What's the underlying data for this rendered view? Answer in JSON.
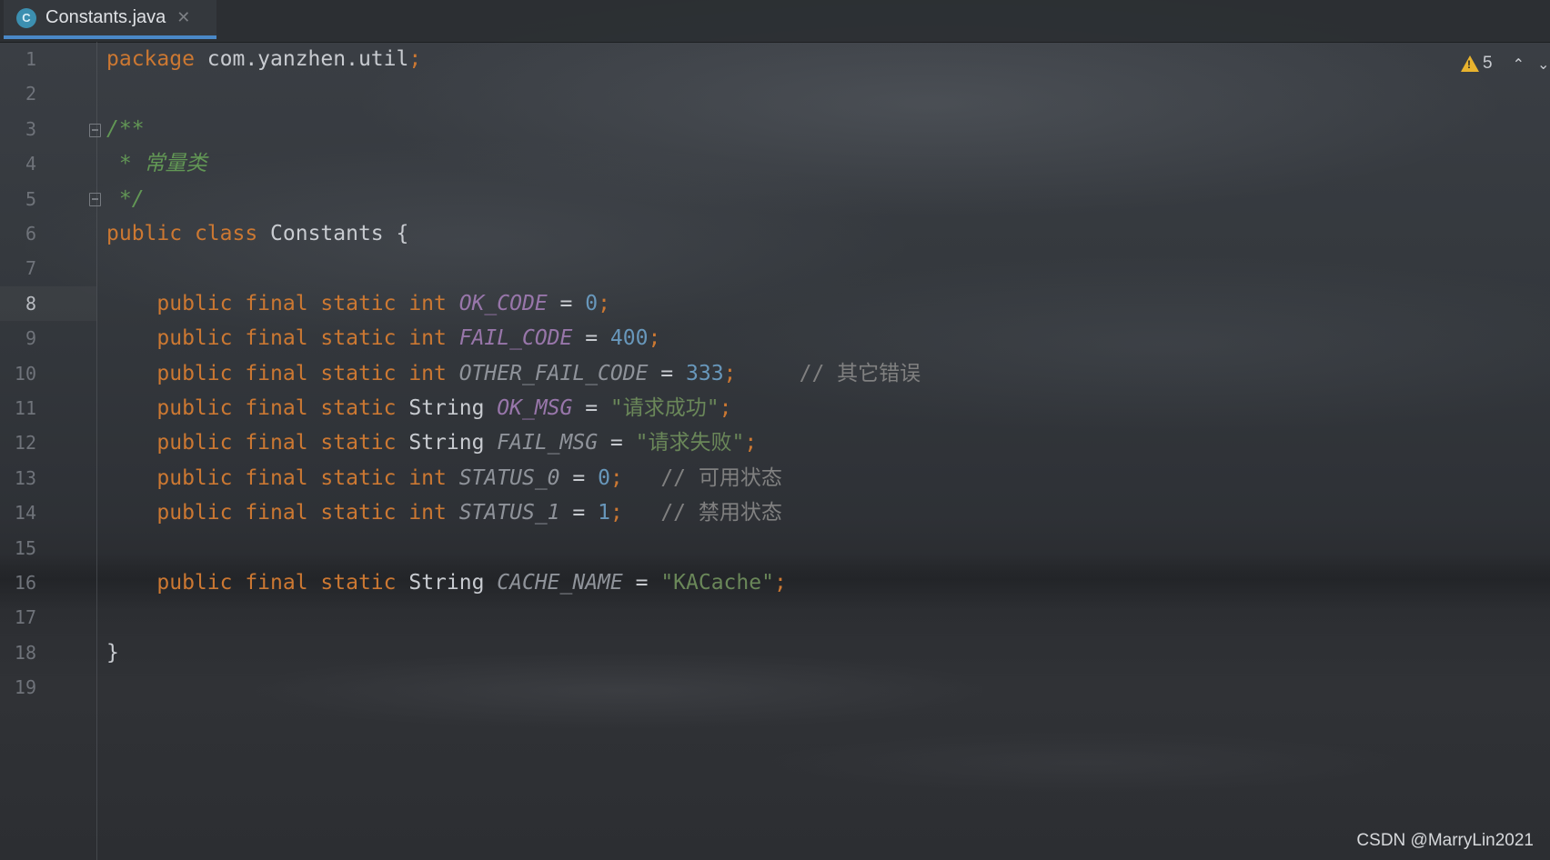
{
  "tab": {
    "icon_letter": "C",
    "label": "Constants.java",
    "close_glyph": "✕"
  },
  "inspection": {
    "warning_count": "5",
    "prev_glyph": "⌃",
    "next_glyph": "⌄"
  },
  "line_numbers": [
    "1",
    "2",
    "3",
    "4",
    "5",
    "6",
    "7",
    "8",
    "9",
    "10",
    "11",
    "12",
    "13",
    "14",
    "15",
    "16",
    "17",
    "18",
    "19"
  ],
  "active_line": "8",
  "code": {
    "l1": {
      "kw": "package",
      "rest": " com.yanzhen.util",
      "semi": ";"
    },
    "l3": {
      "doc": "/**"
    },
    "l4": {
      "doc": " * 常量类"
    },
    "l5": {
      "doc": " */"
    },
    "l6": {
      "kw1": "public",
      "kw2": " class",
      "rest": " Constants {"
    },
    "l8": {
      "mods": "    public final static int ",
      "name": "OK_CODE",
      "eq": " = ",
      "val": "0",
      "semi": ";"
    },
    "l9": {
      "mods": "    public final static int ",
      "name": "FAIL_CODE",
      "eq": " = ",
      "val": "400",
      "semi": ";"
    },
    "l10": {
      "mods": "    public final static int ",
      "name": "OTHER_FAIL_CODE",
      "eq": " = ",
      "val": "333",
      "semi": ";",
      "comment": "     // 其它错误"
    },
    "l11": {
      "mods": "    public final static ",
      "type": "String",
      "name": " OK_MSG",
      "eq": " = ",
      "val": "\"请求成功\"",
      "semi": ";"
    },
    "l12": {
      "mods": "    public final static ",
      "type": "String",
      "name": " FAIL_MSG",
      "eq": " = ",
      "val": "\"请求失败\"",
      "semi": ";"
    },
    "l13": {
      "mods": "    public final static int ",
      "name": "STATUS_0",
      "eq": " = ",
      "val": "0",
      "semi": ";",
      "comment": "   // 可用状态"
    },
    "l14": {
      "mods": "    public final static int ",
      "name": "STATUS_1",
      "eq": " = ",
      "val": "1",
      "semi": ";",
      "comment": "   // 禁用状态"
    },
    "l16": {
      "mods": "    public final static ",
      "type": "String",
      "name": " CACHE_NAME",
      "eq": " = ",
      "val": "\"KACache\"",
      "semi": ";"
    },
    "l18": {
      "rest": "}"
    }
  },
  "watermark": "CSDN @MarryLin2021"
}
